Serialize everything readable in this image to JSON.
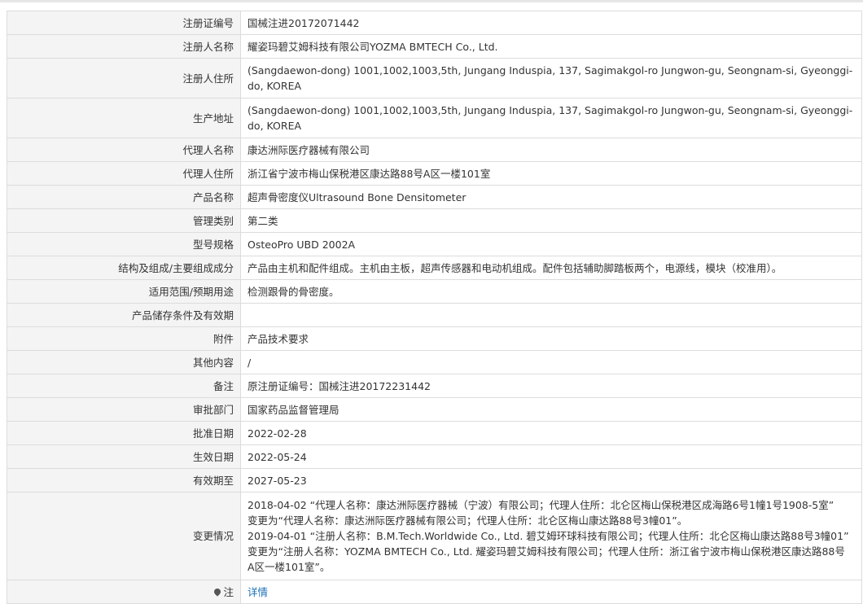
{
  "rows": [
    {
      "label": "注册证编号",
      "value": "国械注进20172071442"
    },
    {
      "label": "注册人名称",
      "value": "耀姿玛碧艾姆科技有限公司YOZMA BMTECH Co., Ltd."
    },
    {
      "label": "注册人住所",
      "value": "(Sangdaewon-dong) 1001,1002,1003,5th, Jungang Induspia, 137, Sagimakgol-ro Jungwon-gu, Seongnam-si, Gyeonggi-do, KOREA"
    },
    {
      "label": "生产地址",
      "value": "(Sangdaewon-dong) 1001,1002,1003,5th, Jungang Induspia, 137, Sagimakgol-ro Jungwon-gu, Seongnam-si, Gyeonggi-do, KOREA"
    },
    {
      "label": "代理人名称",
      "value": "康达洲际医疗器械有限公司"
    },
    {
      "label": "代理人住所",
      "value": "浙江省宁波市梅山保税港区康达路88号A区一楼101室"
    },
    {
      "label": "产品名称",
      "value": "超声骨密度仪Ultrasound Bone Densitometer"
    },
    {
      "label": "管理类别",
      "value": "第二类"
    },
    {
      "label": "型号规格",
      "value": "OsteoPro UBD 2002A"
    },
    {
      "label": "结构及组成/主要组成成分",
      "value": "产品由主机和配件组成。主机由主板，超声传感器和电动机组成。配件包括辅助脚踏板两个，电源线，模块（校准用）。"
    },
    {
      "label": "适用范围/预期用途",
      "value": "检测跟骨的骨密度。"
    },
    {
      "label": "产品储存条件及有效期",
      "value": ""
    },
    {
      "label": "附件",
      "value": "产品技术要求"
    },
    {
      "label": "其他内容",
      "value": "/"
    },
    {
      "label": "备注",
      "value": "原注册证编号：国械注进20172231442"
    },
    {
      "label": "审批部门",
      "value": "国家药品监督管理局"
    },
    {
      "label": "批准日期",
      "value": "2022-02-28"
    },
    {
      "label": "生效日期",
      "value": "2022-05-24"
    },
    {
      "label": "有效期至",
      "value": "2027-05-23"
    }
  ],
  "changes": {
    "label": "变更情况",
    "lines": [
      "2018-04-02 “代理人名称：康达洲际医疗器械（宁波）有限公司；代理人住所：北仑区梅山保税港区成海路6号1幢1号1908-5室”",
      "变更为“代理人名称：康达洲际医疗器械有限公司；代理人住所：北仑区梅山康达路88号3幢01”。",
      "2019-04-01 “注册人名称：B.M.Tech.Worldwide Co., Ltd. 碧艾姆环球科技有限公司；代理人住所：北仑区梅山康达路88号3幢01”",
      "变更为“注册人名称：YOZMA BMTECH Co., Ltd. 耀姿玛碧艾姆科技有限公司；代理人住所：浙江省宁波市梅山保税港区康达路88号",
      "A区一楼101室”。"
    ]
  },
  "note": {
    "label": "注",
    "icon": "location-pin-icon",
    "link_text": "详情"
  },
  "colors": {
    "label_bg": "#f4f4f4",
    "border": "#dcdcdc",
    "link": "#1a6fb5"
  }
}
